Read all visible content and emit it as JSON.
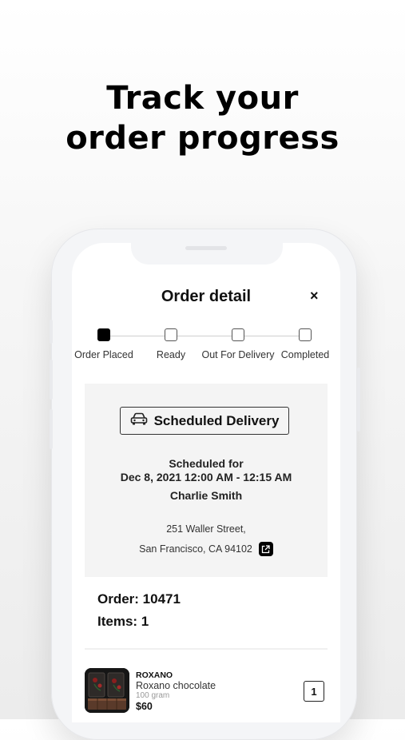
{
  "headline": {
    "line1": "Track your",
    "line2": "order progress"
  },
  "modal": {
    "title": "Order detail",
    "close_label": "×"
  },
  "progress": {
    "steps": [
      {
        "label": "Order Placed",
        "active": true
      },
      {
        "label": "Ready",
        "active": false
      },
      {
        "label": "Out For Delivery",
        "active": false
      },
      {
        "label": "Completed",
        "active": false
      }
    ]
  },
  "delivery": {
    "button_label": "Scheduled Delivery",
    "button_icon": "car-icon",
    "scheduled_for_label": "Scheduled for",
    "scheduled_time": "Dec 8, 2021 12:00 AM - 12:15 AM",
    "customer_name": "Charlie Smith",
    "address_line1": "251 Waller Street,",
    "address_line2": "San Francisco, CA 94102",
    "address_icon": "external-link-icon"
  },
  "order": {
    "order_text": "Order: 10471",
    "items_text": "Items: 1"
  },
  "products": [
    {
      "brand": "ROXANO",
      "name": "Roxano chocolate",
      "weight": "100 gram",
      "price": "$60",
      "quantity": "1"
    }
  ],
  "colors": {
    "active_step": "#000000",
    "card_bg": "#f4f4f4",
    "accent": "#111111"
  }
}
